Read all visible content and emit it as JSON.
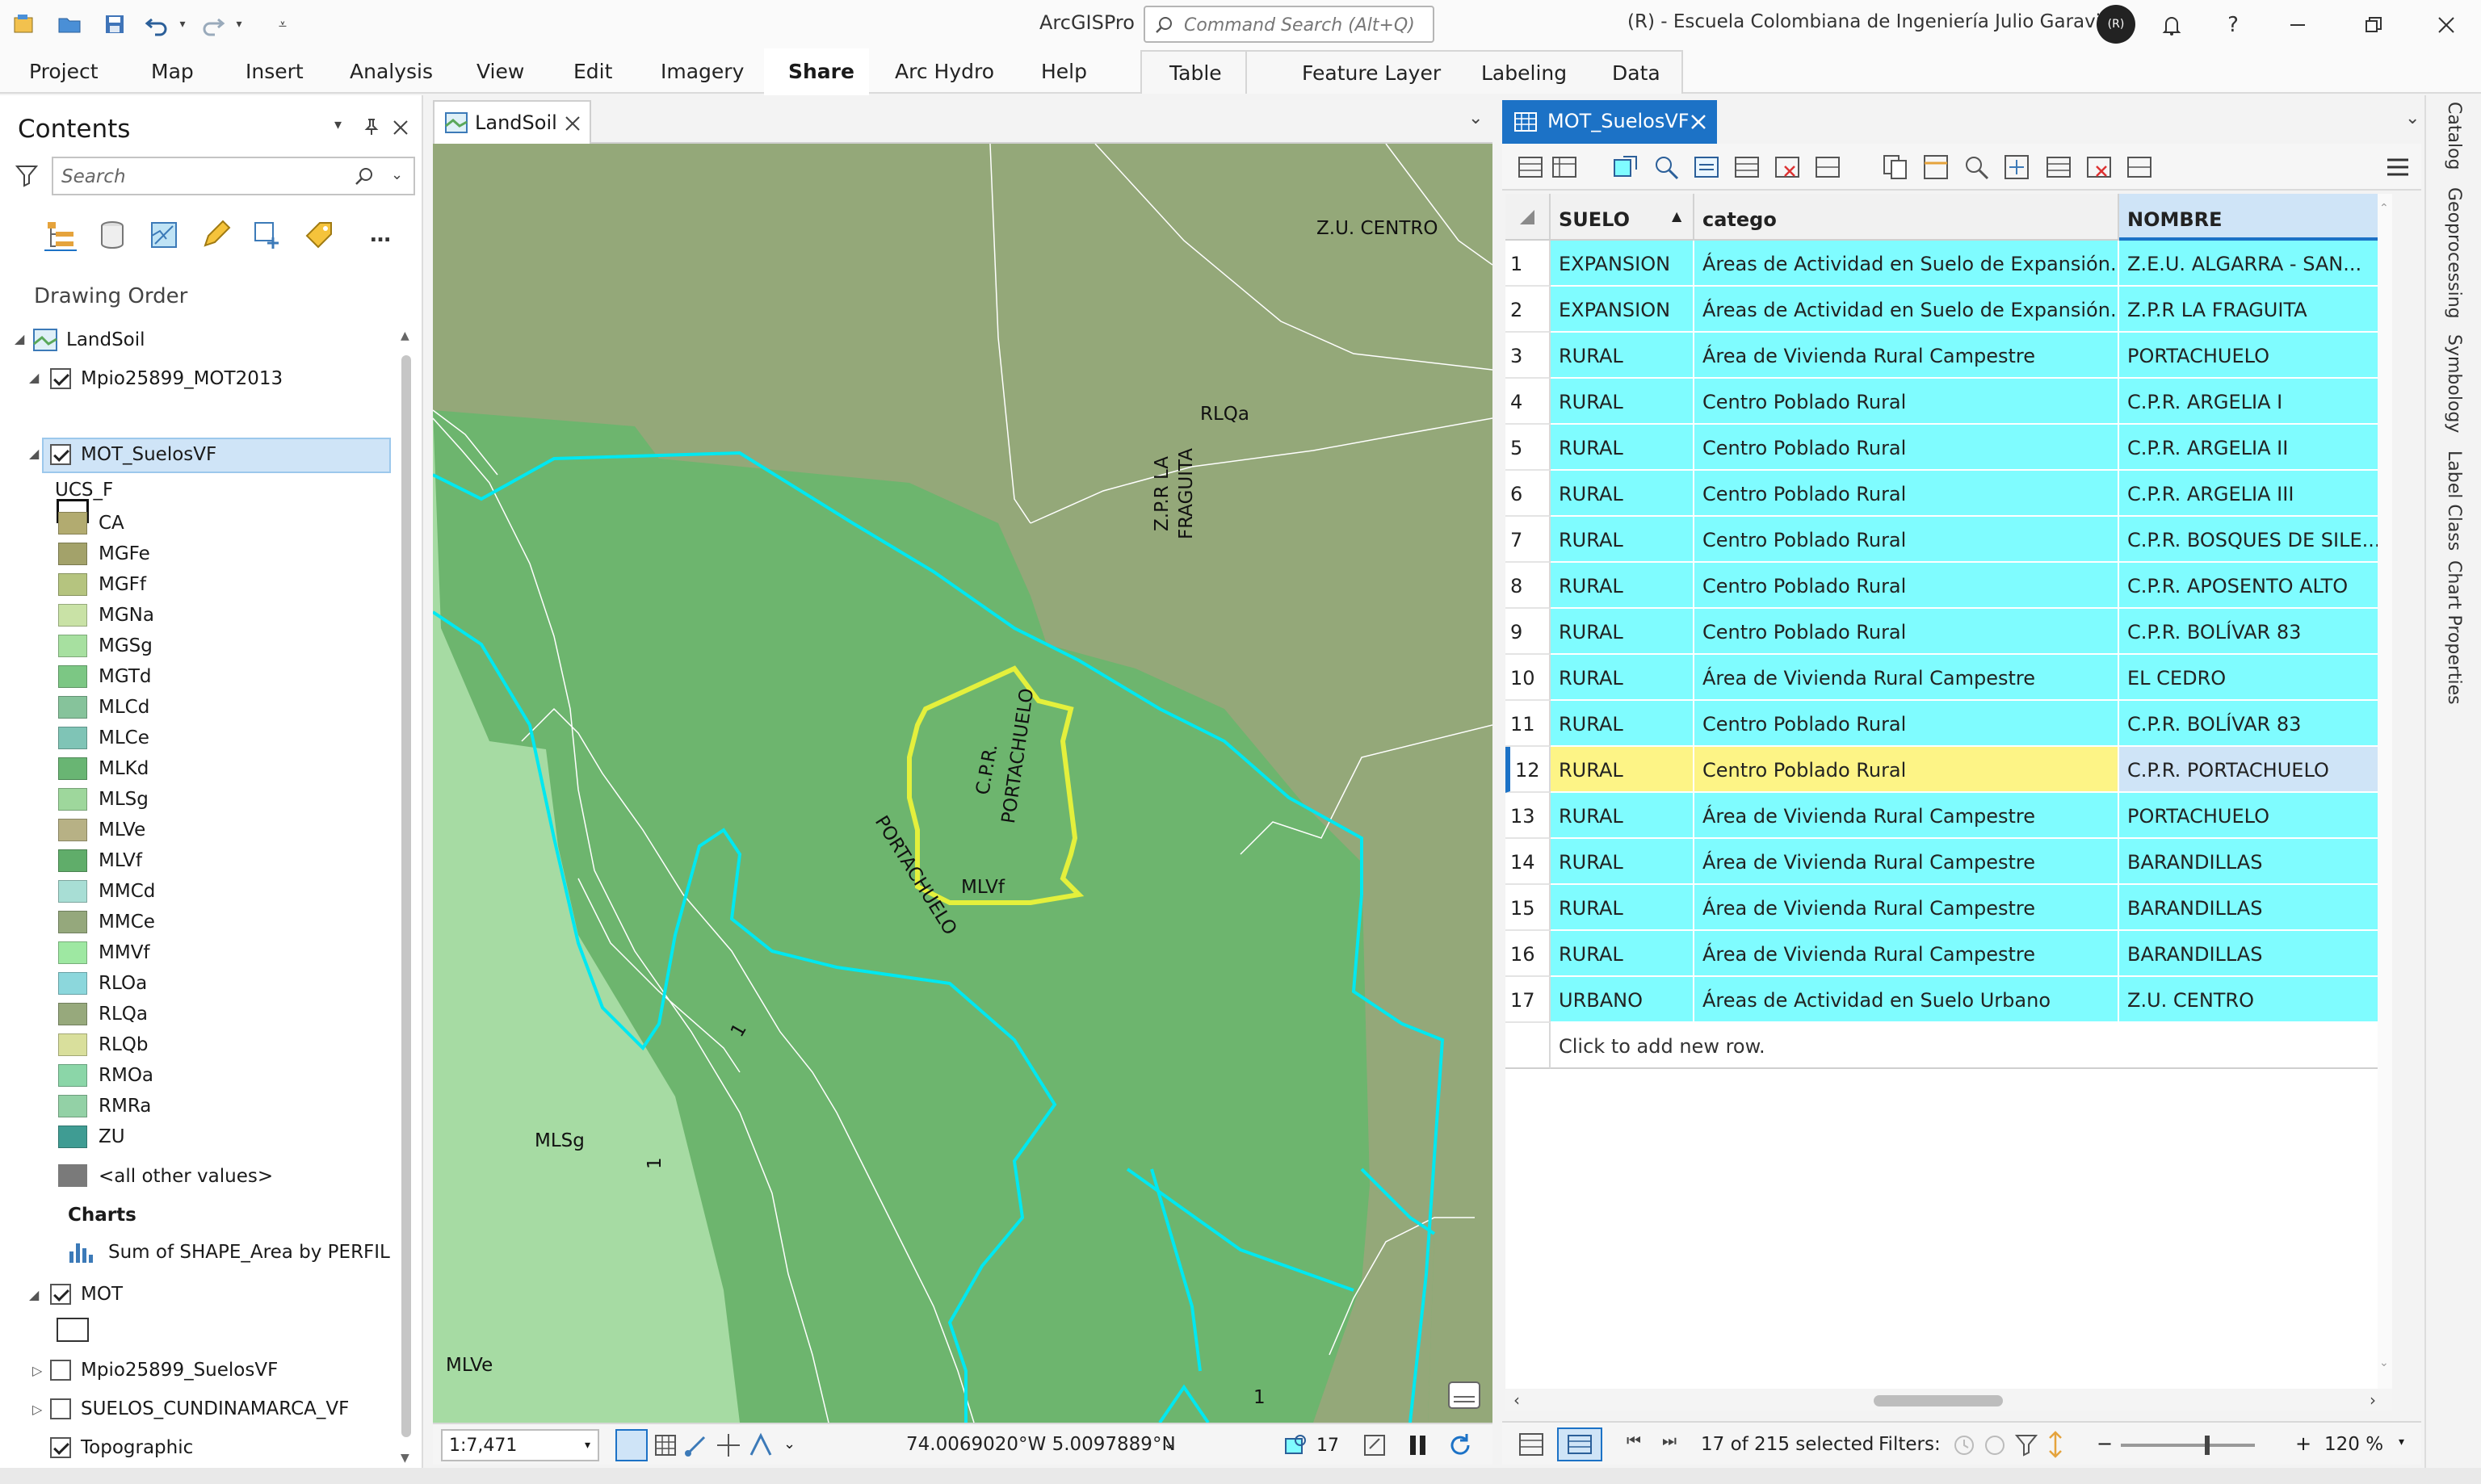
{
  "app": {
    "title": "ArcGISPro",
    "command_search_placeholder": "Command Search (Alt+Q)",
    "org": "(R) - Escuela Colombiana de Ingeniería Julio Garavito",
    "user_initials": "(R)"
  },
  "ribbon": {
    "tabs": [
      "Project",
      "Map",
      "Insert",
      "Analysis",
      "View",
      "Edit",
      "Imagery",
      "Share",
      "Arc Hydro",
      "Help"
    ],
    "active": "Share",
    "context_tabs": [
      "Table",
      "Feature Layer",
      "Labeling",
      "Data"
    ]
  },
  "contents": {
    "title": "Contents",
    "search_placeholder": "Search",
    "section": "Drawing Order",
    "map_name": "LandSoil",
    "layer1": "Mpio25899_MOT2013",
    "layer2": "MOT_SuelosVF",
    "field_name": "UCS_F",
    "legend": [
      {
        "label": "CA",
        "color": "#b2ab70"
      },
      {
        "label": "MGFe",
        "color": "#a3a26a"
      },
      {
        "label": "MGFf",
        "color": "#b5c47f"
      },
      {
        "label": "MGNa",
        "color": "#c9e2a6"
      },
      {
        "label": "MGSg",
        "color": "#a7e0a0"
      },
      {
        "label": "MGTd",
        "color": "#7cc784"
      },
      {
        "label": "MLCd",
        "color": "#86c39b"
      },
      {
        "label": "MLCe",
        "color": "#7fc4b6"
      },
      {
        "label": "MLKd",
        "color": "#69b573"
      },
      {
        "label": "MLSg",
        "color": "#9ed79c"
      },
      {
        "label": "MLVe",
        "color": "#b7b185"
      },
      {
        "label": "MLVf",
        "color": "#60ad6a"
      },
      {
        "label": "MMCd",
        "color": "#a8ded5"
      },
      {
        "label": "MMCe",
        "color": "#95a87c"
      },
      {
        "label": "MMVf",
        "color": "#9ee8a2"
      },
      {
        "label": "RLOa",
        "color": "#8cd7dc"
      },
      {
        "label": "RLQa",
        "color": "#97a97c"
      },
      {
        "label": "RLQb",
        "color": "#d9df9c"
      },
      {
        "label": "RMOa",
        "color": "#8bd6a8"
      },
      {
        "label": "RMRa",
        "color": "#93d1a6"
      },
      {
        "label": "ZU",
        "color": "#3f9c93"
      }
    ],
    "other_values": "<all other values>",
    "charts_header": "Charts",
    "chart_item": "Sum of SHAPE_Area by PERFIL",
    "layer3": "MOT",
    "layer4": "Mpio25899_SuelosVF",
    "layer5": "SUELOS_CUNDINAMARCA_VF",
    "layer6": "Topographic"
  },
  "map": {
    "tab": "LandSoil",
    "labels": {
      "zu_centro": "Z.U. CENTRO",
      "rlqa": "RLQa",
      "zpr_fraguita_1": "Z.P.R LA",
      "zpr_fraguita_2": "FRAGUITA",
      "cpr_1": "C.P.R.",
      "cpr_2": "PORTACHUELO",
      "portachuelo": "PORTACHUELO",
      "mlvf": "MLVf",
      "mlsg": "MLSg",
      "mlve": "MLVe",
      "one_a": "1",
      "one_b": "1",
      "one_c": "1"
    },
    "scale": "1:7,471",
    "coordinates": "74.0069020°W 5.0097889°N",
    "selected_count": "17"
  },
  "table": {
    "tab": "MOT_SuelosVF",
    "columns": [
      "SUELO",
      "catego",
      "NOMBRE"
    ],
    "rows": [
      {
        "n": "1",
        "suelo": "EXPANSION",
        "catego": "Áreas de Actividad en Suelo de Expansión...",
        "nombre": "Z.E.U. ALGARRA - SAN..."
      },
      {
        "n": "2",
        "suelo": "EXPANSION",
        "catego": "Áreas de Actividad en Suelo de Expansión...",
        "nombre": "Z.P.R LA FRAGUITA"
      },
      {
        "n": "3",
        "suelo": "RURAL",
        "catego": "Área de Vivienda Rural Campestre",
        "nombre": "PORTACHUELO"
      },
      {
        "n": "4",
        "suelo": "RURAL",
        "catego": "Centro Poblado Rural",
        "nombre": "C.P.R. ARGELIA I"
      },
      {
        "n": "5",
        "suelo": "RURAL",
        "catego": "Centro Poblado Rural",
        "nombre": "C.P.R. ARGELIA II"
      },
      {
        "n": "6",
        "suelo": "RURAL",
        "catego": "Centro Poblado Rural",
        "nombre": "C.P.R. ARGELIA III"
      },
      {
        "n": "7",
        "suelo": "RURAL",
        "catego": "Centro Poblado Rural",
        "nombre": "C.P.R. BOSQUES DE SILE..."
      },
      {
        "n": "8",
        "suelo": "RURAL",
        "catego": "Centro Poblado Rural",
        "nombre": "C.P.R. APOSENTO ALTO"
      },
      {
        "n": "9",
        "suelo": "RURAL",
        "catego": "Centro Poblado Rural",
        "nombre": "C.P.R. BOLÍVAR 83"
      },
      {
        "n": "10",
        "suelo": "RURAL",
        "catego": "Área de Vivienda Rural Campestre",
        "nombre": "EL CEDRO"
      },
      {
        "n": "11",
        "suelo": "RURAL",
        "catego": "Centro Poblado Rural",
        "nombre": "C.P.R. BOLÍVAR 83"
      },
      {
        "n": "12",
        "suelo": "RURAL",
        "catego": "Centro Poblado Rural",
        "nombre": "C.P.R. PORTACHUELO"
      },
      {
        "n": "13",
        "suelo": "RURAL",
        "catego": "Área de Vivienda Rural Campestre",
        "nombre": "PORTACHUELO"
      },
      {
        "n": "14",
        "suelo": "RURAL",
        "catego": "Área de Vivienda Rural Campestre",
        "nombre": "BARANDILLAS"
      },
      {
        "n": "15",
        "suelo": "RURAL",
        "catego": "Área de Vivienda Rural Campestre",
        "nombre": "BARANDILLAS"
      },
      {
        "n": "16",
        "suelo": "RURAL",
        "catego": "Área de Vivienda Rural Campestre",
        "nombre": "BARANDILLAS"
      },
      {
        "n": "17",
        "suelo": "URBANO",
        "catego": "Áreas de Actividad en Suelo Urbano",
        "nombre": "Z.U. CENTRO"
      }
    ],
    "highlighted_row": "12",
    "add_row": "Click to add new row.",
    "selection_status": "17 of 215 selected",
    "filters_label": "Filters:",
    "zoom": "120 %",
    "selected_color": "#7ffcff",
    "highlight_color": "#fdf486"
  },
  "dock": [
    "Catalog",
    "Geoprocessing",
    "Symbology",
    "Label Class",
    "Chart Properties"
  ]
}
